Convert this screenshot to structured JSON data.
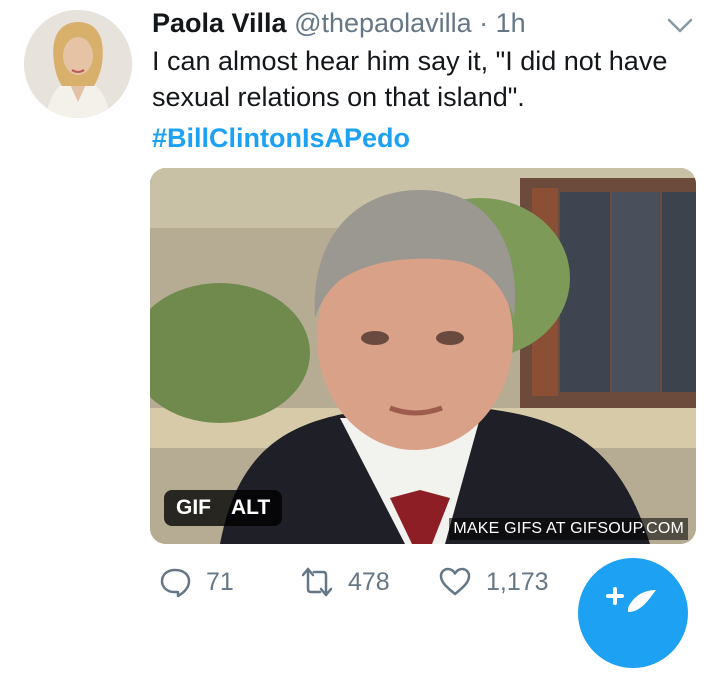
{
  "tweet": {
    "author_name": "Paola Villa",
    "handle": "@thepaolavilla",
    "separator": "·",
    "time": "1h",
    "text": "I can almost hear him say it, \"I did not have sexual relations on that island\".",
    "hashtag": "#BillClintonIsAPedo"
  },
  "media": {
    "gif_badge": "GIF",
    "alt_badge": "ALT",
    "watermark": "MAKE GIFS AT GIFSOUP.COM"
  },
  "actions": {
    "reply_count": "71",
    "retweet_count": "478",
    "like_count": "1,173"
  },
  "icons": {
    "menu": "chevron-down-icon",
    "reply": "reply-icon",
    "retweet": "retweet-icon",
    "like": "heart-icon",
    "compose": "compose-tweet-icon"
  },
  "colors": {
    "link": "#1da1f2",
    "muted": "#657786",
    "text": "#14171a"
  }
}
